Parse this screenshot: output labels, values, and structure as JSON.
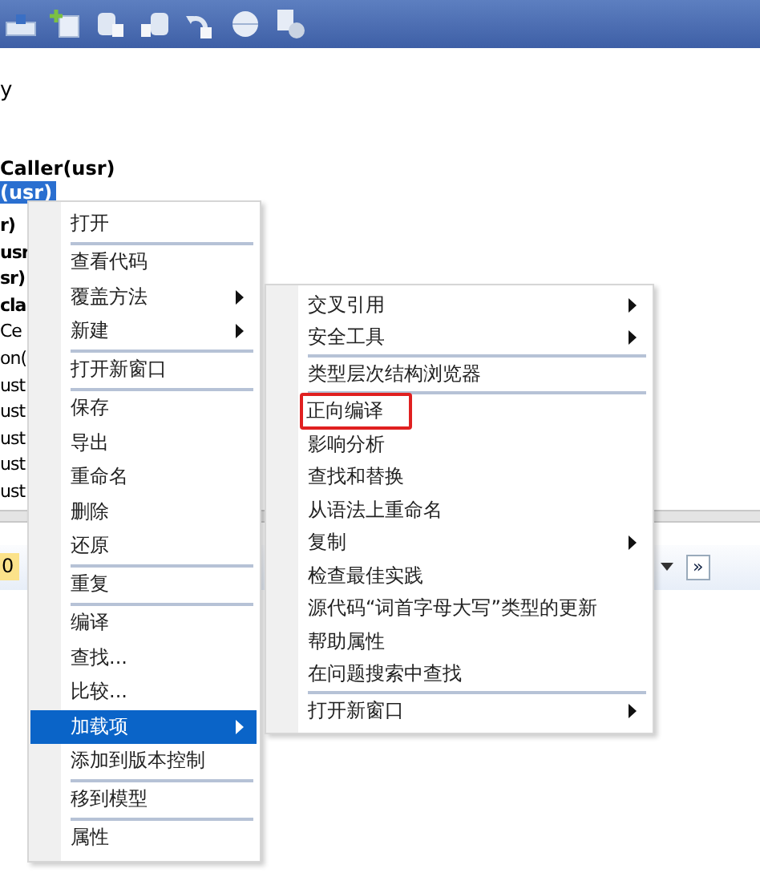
{
  "background": {
    "heading_fragment": "y",
    "caller": "Caller(usr)",
    "selected_node": "(usr)",
    "rows": [
      {
        "text": "r)",
        "bold": true
      },
      {
        "text": "usr",
        "bold": true
      },
      {
        "text": "sr)",
        "bold": true
      },
      {
        "text": "cla",
        "bold": true
      },
      {
        "text": "Ce",
        "bold": false
      },
      {
        "text": "on(",
        "bold": false
      },
      {
        "text": "ust",
        "bold": false
      },
      {
        "text": "ust",
        "bold": false
      },
      {
        "text": "ust",
        "bold": false
      },
      {
        "text": "ust",
        "bold": false
      },
      {
        "text": "ust",
        "bold": false
      }
    ],
    "status_chip": "0",
    "overflow_button": "»"
  },
  "context_menu": [
    {
      "kind": "item",
      "label": "打开",
      "submenu": false,
      "selected": false
    },
    {
      "kind": "separator"
    },
    {
      "kind": "item",
      "label": "查看代码",
      "submenu": false,
      "selected": false
    },
    {
      "kind": "item",
      "label": "覆盖方法",
      "submenu": true,
      "selected": false
    },
    {
      "kind": "item",
      "label": "新建",
      "submenu": true,
      "selected": false
    },
    {
      "kind": "separator"
    },
    {
      "kind": "item",
      "label": "打开新窗口",
      "submenu": false,
      "selected": false
    },
    {
      "kind": "separator"
    },
    {
      "kind": "item",
      "label": "保存",
      "submenu": false,
      "selected": false
    },
    {
      "kind": "item",
      "label": "导出",
      "submenu": false,
      "selected": false
    },
    {
      "kind": "item",
      "label": "重命名",
      "submenu": false,
      "selected": false
    },
    {
      "kind": "item",
      "label": "删除",
      "submenu": false,
      "selected": false
    },
    {
      "kind": "item",
      "label": "还原",
      "submenu": false,
      "selected": false
    },
    {
      "kind": "separator"
    },
    {
      "kind": "item",
      "label": "重复",
      "submenu": false,
      "selected": false
    },
    {
      "kind": "separator"
    },
    {
      "kind": "item",
      "label": "编译",
      "submenu": false,
      "selected": false
    },
    {
      "kind": "item",
      "label": "查找...",
      "submenu": false,
      "selected": false
    },
    {
      "kind": "item",
      "label": "比较...",
      "submenu": false,
      "selected": false
    },
    {
      "kind": "item",
      "label": "加载项",
      "submenu": true,
      "selected": true
    },
    {
      "kind": "item",
      "label": "添加到版本控制",
      "submenu": false,
      "selected": false
    },
    {
      "kind": "separator"
    },
    {
      "kind": "item",
      "label": "移到模型",
      "submenu": false,
      "selected": false
    },
    {
      "kind": "separator"
    },
    {
      "kind": "item",
      "label": "属性",
      "submenu": false,
      "selected": false
    }
  ],
  "submenu": [
    {
      "kind": "item",
      "label": "交叉引用",
      "submenu": true,
      "highlighted": false
    },
    {
      "kind": "item",
      "label": "安全工具",
      "submenu": true,
      "highlighted": false
    },
    {
      "kind": "separator"
    },
    {
      "kind": "item",
      "label": "类型层次结构浏览器",
      "submenu": false,
      "highlighted": false
    },
    {
      "kind": "separator"
    },
    {
      "kind": "item",
      "label": "正向编译",
      "submenu": false,
      "highlighted": true
    },
    {
      "kind": "item",
      "label": "影响分析",
      "submenu": false,
      "highlighted": false
    },
    {
      "kind": "item",
      "label": "查找和替换",
      "submenu": false,
      "highlighted": false
    },
    {
      "kind": "item",
      "label": "从语法上重命名",
      "submenu": false,
      "highlighted": false
    },
    {
      "kind": "item",
      "label": "复制",
      "submenu": true,
      "highlighted": false
    },
    {
      "kind": "item",
      "label": "检查最佳实践",
      "submenu": false,
      "highlighted": false
    },
    {
      "kind": "item",
      "label": "源代码“词首字母大写”类型的更新",
      "submenu": false,
      "highlighted": false
    },
    {
      "kind": "item",
      "label": "帮助属性",
      "submenu": false,
      "highlighted": false
    },
    {
      "kind": "item",
      "label": "在问题搜索中查找",
      "submenu": false,
      "highlighted": false
    },
    {
      "kind": "separator"
    },
    {
      "kind": "item",
      "label": "打开新窗口",
      "submenu": true,
      "highlighted": false
    }
  ]
}
